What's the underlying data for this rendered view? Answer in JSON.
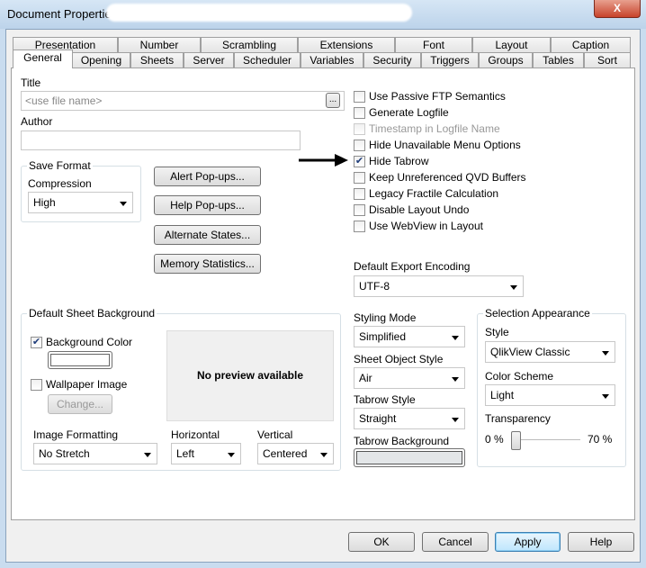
{
  "window": {
    "title": "Document Properties",
    "close": "X"
  },
  "tabs_row1": [
    "Presentation",
    "Number",
    "Scrambling",
    "Extensions",
    "Font",
    "Layout",
    "Caption"
  ],
  "tabs_row2": [
    "General",
    "Opening",
    "Sheets",
    "Server",
    "Scheduler",
    "Variables",
    "Security",
    "Triggers",
    "Groups",
    "Tables",
    "Sort"
  ],
  "active_tab": "General",
  "general": {
    "title_label": "Title",
    "title_placeholder": "<use file name>",
    "browse": "...",
    "author_label": "Author",
    "author_value": "",
    "save_format": {
      "label": "Save Format",
      "compression_label": "Compression",
      "compression_value": "High"
    },
    "buttons": [
      "Alert Pop-ups...",
      "Help Pop-ups...",
      "Alternate States...",
      "Memory Statistics..."
    ],
    "options": [
      {
        "label": "Use Passive FTP Semantics",
        "checked": false,
        "enabled": true
      },
      {
        "label": "Generate Logfile",
        "checked": false,
        "enabled": true
      },
      {
        "label": "Timestamp in Logfile Name",
        "checked": false,
        "enabled": false
      },
      {
        "label": "Hide Unavailable Menu Options",
        "checked": false,
        "enabled": true
      },
      {
        "label": "Hide Tabrow",
        "checked": true,
        "enabled": true
      },
      {
        "label": "Keep Unreferenced QVD Buffers",
        "checked": false,
        "enabled": true
      },
      {
        "label": "Legacy Fractile Calculation",
        "checked": false,
        "enabled": true
      },
      {
        "label": "Disable Layout Undo",
        "checked": false,
        "enabled": true
      },
      {
        "label": "Use WebView in Layout",
        "checked": false,
        "enabled": true
      }
    ],
    "export_encoding": {
      "label": "Default Export Encoding",
      "value": "UTF-8"
    },
    "sheet_background": {
      "label": "Default Sheet Background",
      "background_color": "Background Color",
      "background_color_checked": true,
      "wallpaper": "Wallpaper Image",
      "wallpaper_checked": false,
      "change": "Change...",
      "preview": "No preview available",
      "image_formatting_label": "Image Formatting",
      "image_formatting": "No Stretch",
      "horizontal_label": "Horizontal",
      "horizontal": "Left",
      "vertical_label": "Vertical",
      "vertical": "Centered"
    },
    "styling_mode": {
      "label": "Styling Mode",
      "value": "Simplified"
    },
    "sheet_object_style": {
      "label": "Sheet Object Style",
      "value": "Air"
    },
    "tabrow_style": {
      "label": "Tabrow Style",
      "value": "Straight"
    },
    "tabrow_background": {
      "label": "Tabrow Background"
    },
    "selection": {
      "label": "Selection Appearance",
      "style_label": "Style",
      "style": "QlikView Classic",
      "scheme_label": "Color Scheme",
      "scheme": "Light",
      "transparency_label": "Transparency",
      "min": "0 %",
      "max": "70 %",
      "transparency_value": 0
    }
  },
  "footer": {
    "ok": "OK",
    "cancel": "Cancel",
    "apply": "Apply",
    "help": "Help"
  }
}
